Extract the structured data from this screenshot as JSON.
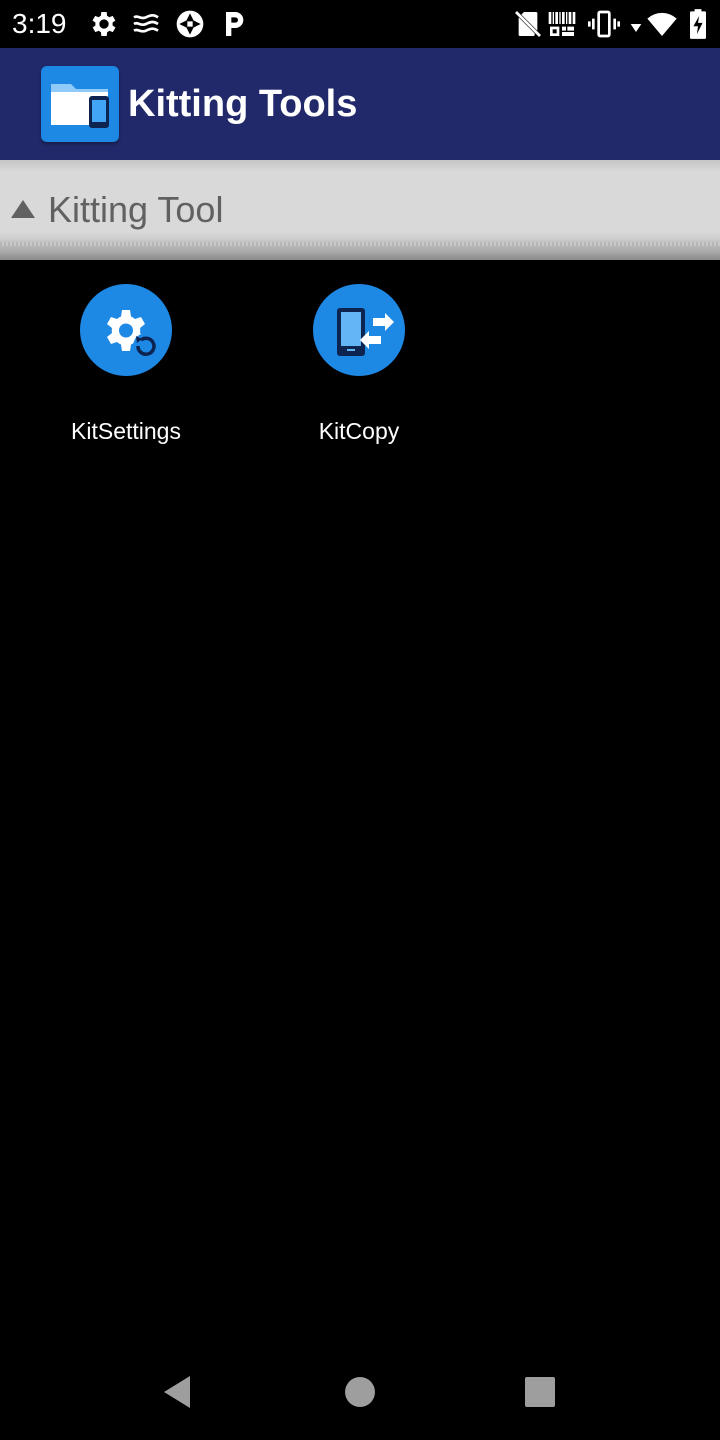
{
  "status_bar": {
    "time": "3:19",
    "icons": [
      "settings-gear-icon",
      "wave-icon",
      "aperture-icon",
      "parking-p-icon",
      "no-sim-icon",
      "barcode-icon",
      "vibrate-icon",
      "data-arrow-icon",
      "wifi-icon",
      "battery-charging-icon"
    ]
  },
  "app_bar": {
    "title": "Kitting Tools",
    "logo_icon": "folder-phone-icon",
    "color": "#21296a"
  },
  "section": {
    "title": "Kitting Tool",
    "arrow_icon": "triangle-up-icon"
  },
  "apps": [
    {
      "label": "KitSettings",
      "icon": "gear-restore-icon"
    },
    {
      "label": "KitCopy",
      "icon": "phone-transfer-icon"
    }
  ],
  "nav_bar": {
    "buttons": [
      "back-icon",
      "home-icon",
      "recents-icon"
    ]
  },
  "colors": {
    "accent": "#1e88e5",
    "background": "#000000",
    "section_bg": "#d9d9d9"
  }
}
